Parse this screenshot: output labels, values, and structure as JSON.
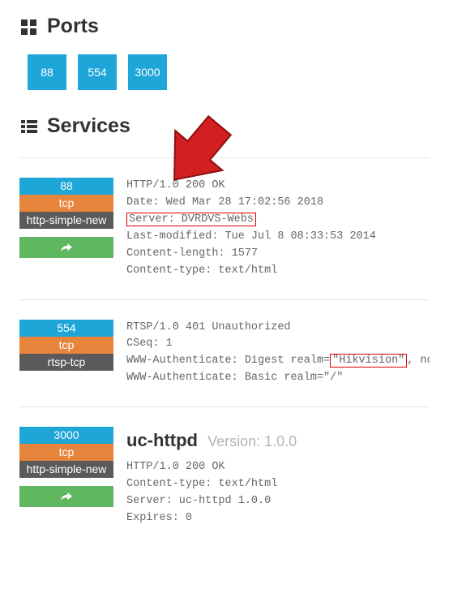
{
  "ports_section": {
    "title": "Ports"
  },
  "ports": [
    "88",
    "554",
    "3000"
  ],
  "services_section": {
    "title": "Services"
  },
  "services": [
    {
      "port": "88",
      "proto": "tcp",
      "service": "http-simple-new",
      "lines_pre1": "HTTP/1.0 200 OK",
      "lines_pre2": "Date: Wed Mar 28 17:02:56 2018",
      "highlight1": "Server: DVRDVS-Webs",
      "lines_post1": "Last-modified: Tue Jul  8 08:33:53 2014",
      "lines_post2": "Content-length: 1577",
      "lines_post3": "Content-type: text/html"
    },
    {
      "port": "554",
      "proto": "tcp",
      "service": "rtsp-tcp",
      "lines_pre1": "RTSP/1.0 401 Unauthorized",
      "lines_pre2": "CSeq: 1",
      "auth_prefix": "WWW-Authenticate: Digest realm=",
      "highlight1": "\"Hikvision\"",
      "auth_suffix": ", nonce=",
      "lines_post1": "WWW-Authenticate: Basic realm=\"/\""
    },
    {
      "port": "3000",
      "proto": "tcp",
      "service": "http-simple-new",
      "title": "uc-httpd",
      "version_label": "Version: ",
      "version_value": "1.0.0",
      "lines_pre1": "HTTP/1.0 200 OK",
      "lines_pre2": "Content-type: text/html",
      "lines_pre3": "Server: uc-httpd 1.0.0",
      "lines_pre4": "Expires: 0"
    }
  ]
}
